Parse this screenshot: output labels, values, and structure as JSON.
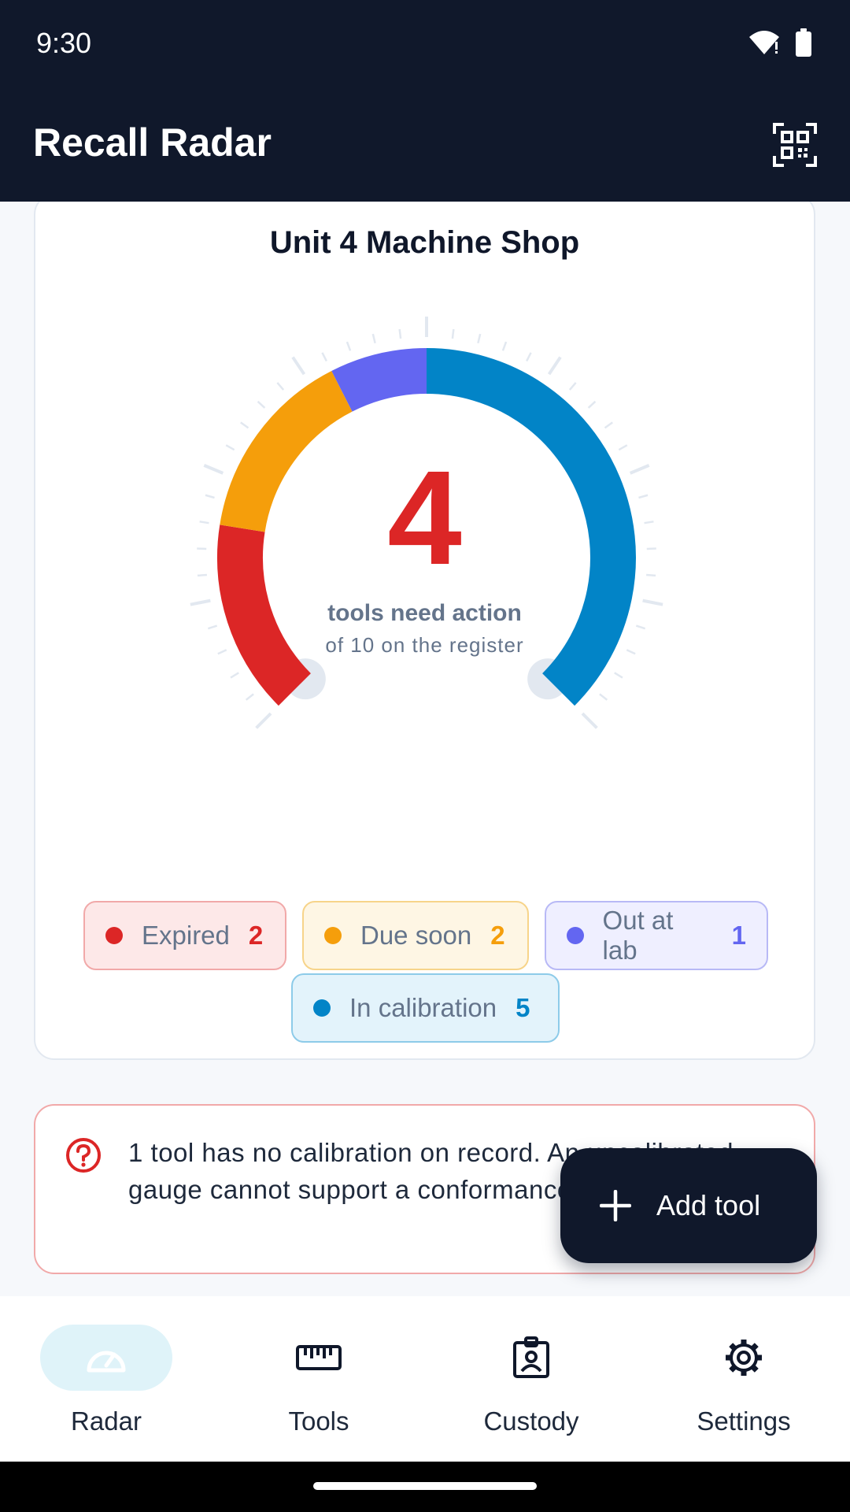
{
  "status": {
    "time": "9:30"
  },
  "app": {
    "title": "Recall Radar"
  },
  "card": {
    "title": "Unit 4 Machine Shop",
    "needs_action": "4",
    "needs_action_label": "tools need action",
    "total_label": "of 10 on the register"
  },
  "gauge": {
    "total": 10,
    "segments": [
      {
        "key": "expired",
        "value": 2,
        "color": "#dc2626"
      },
      {
        "key": "due_soon",
        "value": 2,
        "color": "#f59e0b"
      },
      {
        "key": "out_at_lab",
        "value": 1,
        "color": "#6366f1"
      },
      {
        "key": "in_calibration",
        "value": 5,
        "color": "#0284c7"
      }
    ]
  },
  "chips": {
    "expired": {
      "label": "Expired",
      "count": "2",
      "color": "#dc2626"
    },
    "due_soon": {
      "label": "Due soon",
      "count": "2",
      "color": "#f59e0b"
    },
    "out_at_lab": {
      "label": "Out at lab",
      "count": "1",
      "color": "#6366f1"
    },
    "in_calibration": {
      "label": "In calibration",
      "count": "5",
      "color": "#0284c7"
    }
  },
  "alert": {
    "text": "1 tool has no calibration on record. An uncalibrated gauge cannot support a conformance decision."
  },
  "fab": {
    "label": "Add tool"
  },
  "nav": {
    "radar": "Radar",
    "tools": "Tools",
    "custody": "Custody",
    "settings": "Settings"
  }
}
